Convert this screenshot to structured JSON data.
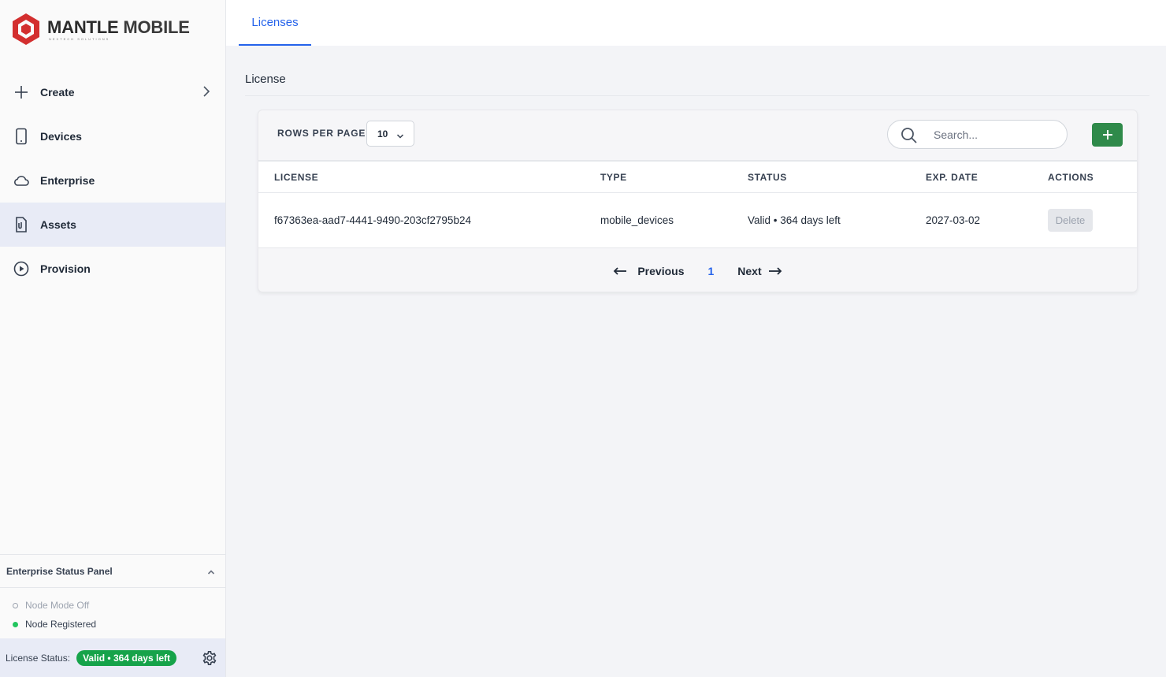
{
  "brand": {
    "name_part1": "MANTLE",
    "name_part2": "MOBILE",
    "tagline": "NEXTECH SOLUTIONS",
    "logo_color": "#d32f2f"
  },
  "sidebar": {
    "items": [
      {
        "label": "Create",
        "icon": "plus-icon",
        "has_submenu": true
      },
      {
        "label": "Devices",
        "icon": "smartphone-icon"
      },
      {
        "label": "Enterprise",
        "icon": "cloud-icon"
      },
      {
        "label": "Assets",
        "icon": "file-attachment-icon",
        "active": true
      },
      {
        "label": "Provision",
        "icon": "play-circle-icon"
      }
    ],
    "status_panel": {
      "title": "Enterprise Status Panel",
      "rows": [
        {
          "label": "Node Mode Off",
          "state": "off"
        },
        {
          "label": "Node Registered",
          "state": "on"
        }
      ]
    },
    "license_status": {
      "label": "License Status:",
      "badge": "Valid • 364 days left",
      "badge_color": "#16a34a"
    }
  },
  "tabs": [
    {
      "label": "Licenses",
      "active": true
    }
  ],
  "page": {
    "title": "License"
  },
  "table_controls": {
    "rows_per_page_label": "ROWS PER PAGE:",
    "rows_per_page_value": "10",
    "search_placeholder": "Search..."
  },
  "table": {
    "columns": [
      "LICENSE",
      "TYPE",
      "STATUS",
      "EXP. DATE",
      "ACTIONS"
    ],
    "rows": [
      {
        "license": "f67363ea-aad7-4441-9490-203cf2795b24",
        "type": "mobile_devices",
        "status": "Valid • 364 days left",
        "exp_date": "2027-03-02",
        "action": "Delete"
      }
    ]
  },
  "pagination": {
    "previous": "Previous",
    "current_page": "1",
    "next": "Next"
  },
  "colors": {
    "accent": "#2563eb",
    "add_button": "#2f8a4a",
    "active_nav": "#e8ebf6"
  }
}
